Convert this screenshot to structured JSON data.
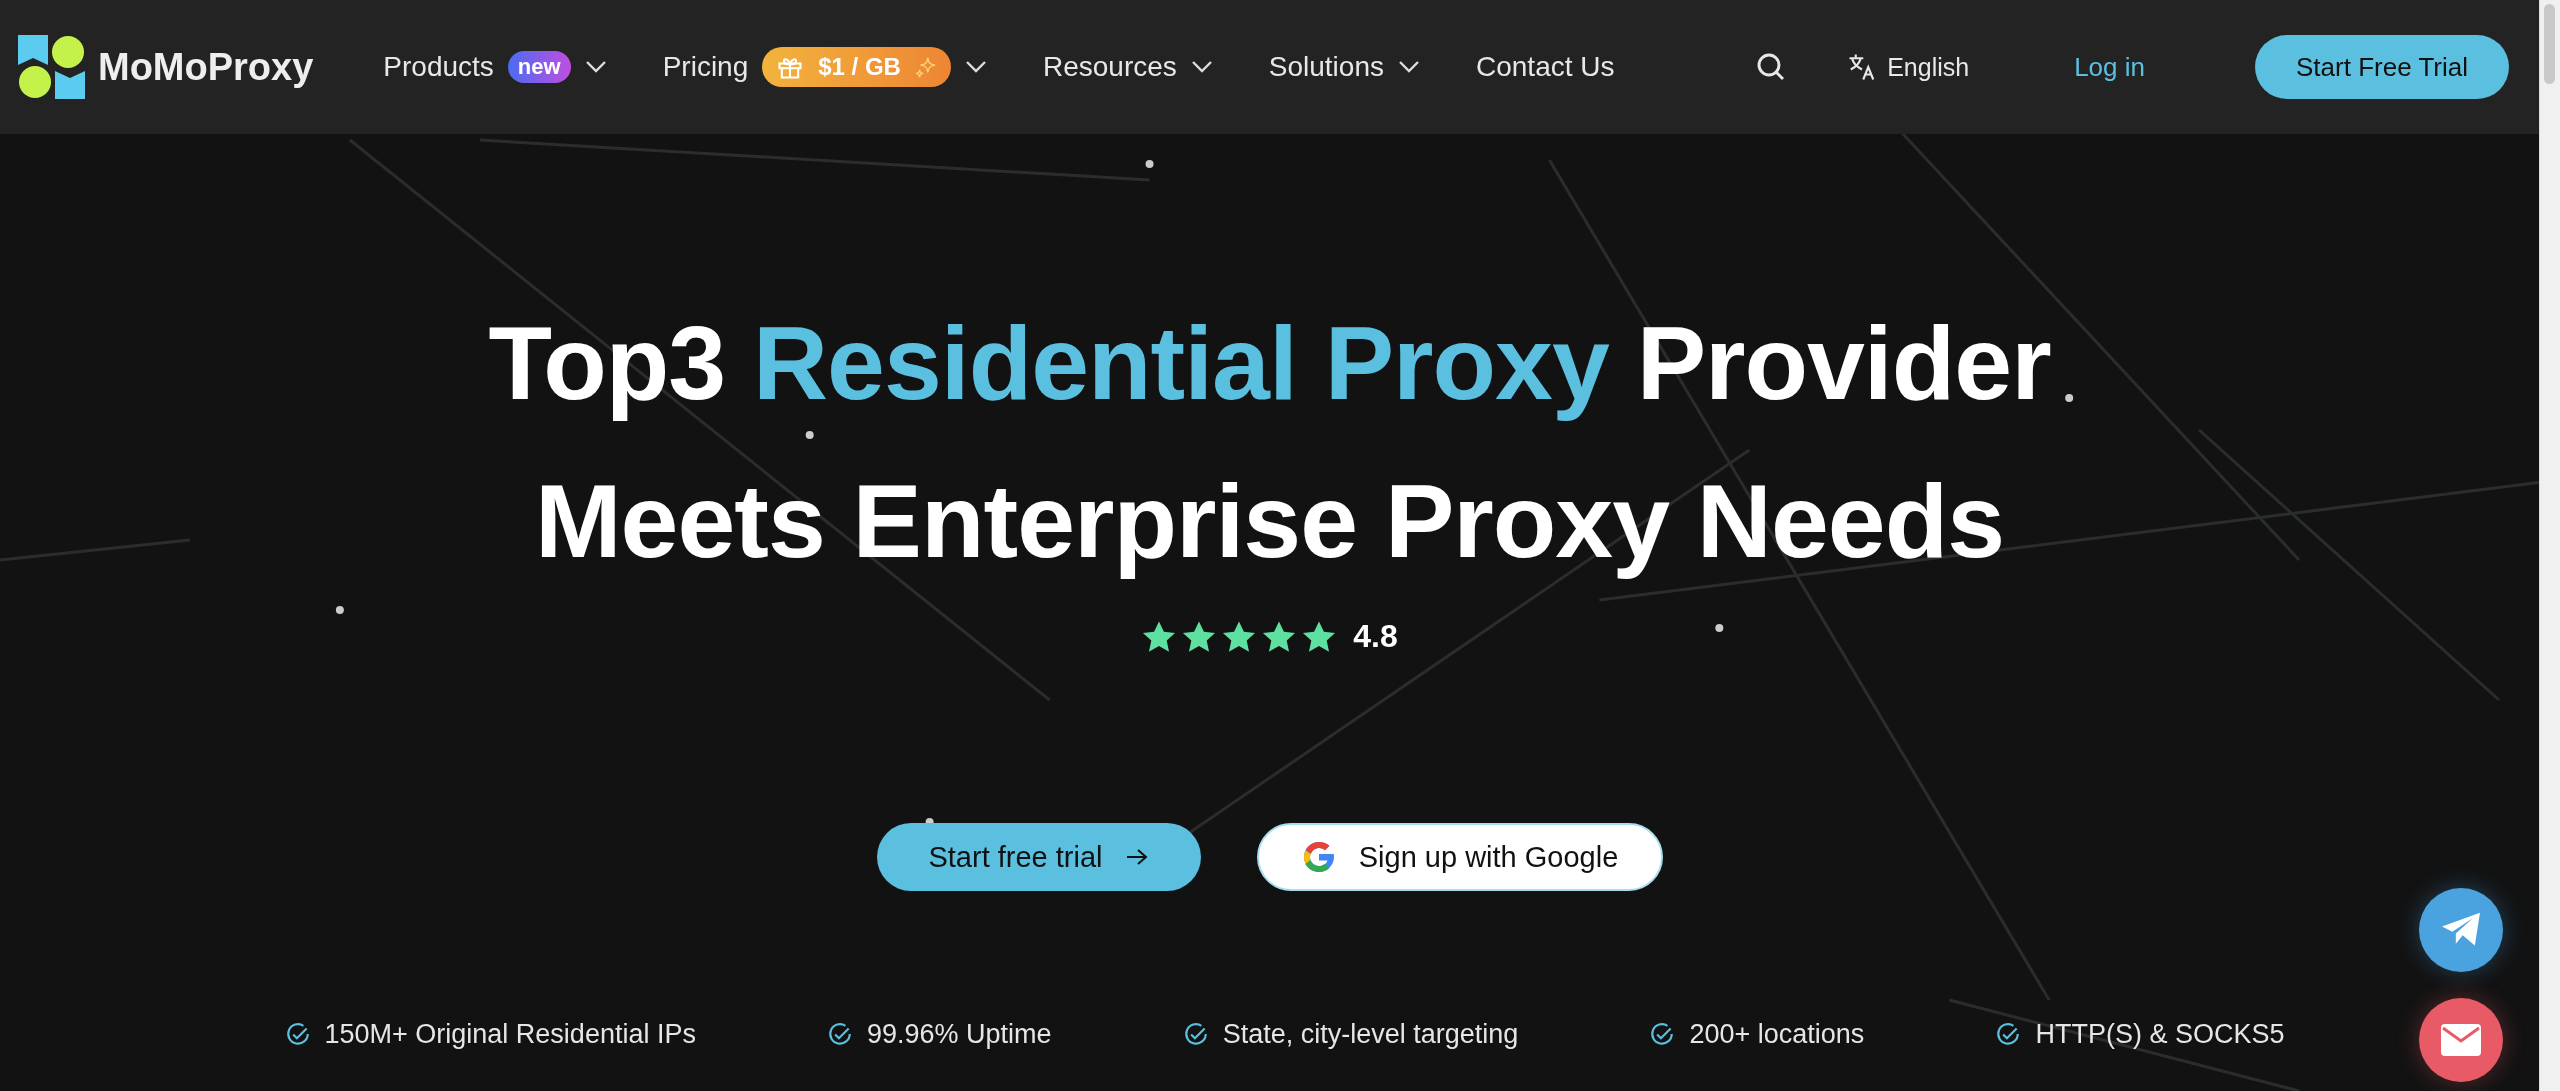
{
  "brand": "MoMoProxy",
  "nav": [
    {
      "label": "Products",
      "has_menu": true,
      "badge": {
        "kind": "new",
        "text": "new"
      }
    },
    {
      "label": "Pricing",
      "has_menu": true,
      "badge": {
        "kind": "price",
        "text": "$1 / GB"
      }
    },
    {
      "label": "Resources",
      "has_menu": true
    },
    {
      "label": "Solutions",
      "has_menu": true
    },
    {
      "label": "Contact Us",
      "has_menu": false
    }
  ],
  "language": "English",
  "login": "Log in",
  "cta": "Start Free Trial",
  "headline": [
    [
      {
        "text": "Top3 ",
        "highlight": false
      },
      {
        "text": "Residential Proxy",
        "highlight": true
      },
      {
        "text": " Provider",
        "highlight": false
      }
    ],
    [
      {
        "text": "Meets Enterprise Proxy Needs",
        "highlight": false
      }
    ]
  ],
  "rating": {
    "stars": 5,
    "score": "4.8"
  },
  "buttons": [
    {
      "kind": "primary",
      "label": "Start free trial"
    },
    {
      "kind": "google",
      "label": "Sign up with Google"
    }
  ],
  "features": [
    "150M+ Original Residential IPs",
    "99.96% Uptime",
    "State, city-level targeting",
    "200+ locations",
    "HTTP(S) & SOCKS5"
  ]
}
